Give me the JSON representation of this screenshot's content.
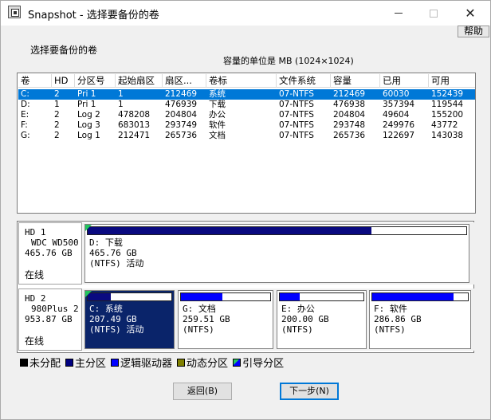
{
  "window": {
    "title": "Snapshot - 选择要备份的卷",
    "help_button": "帮助",
    "minimize_glyph": "—",
    "maximize_glyph": "□",
    "close_glyph": "✕"
  },
  "prompt": "选择要备份的卷",
  "unit_note": "容量的单位是 MB (1024×1024)",
  "volume_table": {
    "columns": [
      "卷",
      "HD",
      "分区号",
      "起始扇区",
      "扇区...",
      "卷标",
      "文件系统",
      "容量",
      "已用",
      "可用"
    ],
    "rows": [
      {
        "vol": "C:",
        "hd": "2",
        "part": "Pri 1",
        "start": "1",
        "sectors": "212469",
        "label": "系统",
        "fs": "07-NTFS",
        "capacity": "212469",
        "used": "60030",
        "free": "152439",
        "selected": true
      },
      {
        "vol": "D:",
        "hd": "1",
        "part": "Pri 1",
        "start": "1",
        "sectors": "476939",
        "label": "下载",
        "fs": "07-NTFS",
        "capacity": "476938",
        "used": "357394",
        "free": "119544",
        "selected": false
      },
      {
        "vol": "E:",
        "hd": "2",
        "part": "Log 2",
        "start": "478208",
        "sectors": "204804",
        "label": "办公",
        "fs": "07-NTFS",
        "capacity": "204804",
        "used": "49604",
        "free": "155200",
        "selected": false
      },
      {
        "vol": "F:",
        "hd": "2",
        "part": "Log 3",
        "start": "683013",
        "sectors": "293749",
        "label": "软件",
        "fs": "07-NTFS",
        "capacity": "293748",
        "used": "249976",
        "free": "43772",
        "selected": false
      },
      {
        "vol": "G:",
        "hd": "2",
        "part": "Log 1",
        "start": "212471",
        "sectors": "265736",
        "label": "文档",
        "fs": "07-NTFS",
        "capacity": "265736",
        "used": "122697",
        "free": "143038",
        "selected": false
      }
    ]
  },
  "disks": [
    {
      "name": "HD 1",
      "model": "WDC WD500",
      "size": "465.76 GB",
      "status": "在线",
      "partitions": [
        {
          "line1": "D: 下载",
          "line2": "465.76 GB",
          "line3": "(NTFS) 活动",
          "used_fraction": 0.75,
          "type": "primary",
          "boot": true,
          "selected": false
        }
      ]
    },
    {
      "name": "HD 2",
      "model": "980Plus 2",
      "size": "953.87 GB",
      "status": "在线",
      "partitions": [
        {
          "line1": "C: 系统",
          "line2": "207.49 GB",
          "line3": "(NTFS) 活动",
          "used_fraction": 0.28,
          "type": "primary",
          "boot": true,
          "selected": true
        },
        {
          "line1": "G: 文档",
          "line2": "259.51 GB",
          "line3": "(NTFS)",
          "used_fraction": 0.46,
          "type": "logical",
          "boot": false,
          "selected": false
        },
        {
          "line1": "E: 办公",
          "line2": "200.00 GB",
          "line3": "(NTFS)",
          "used_fraction": 0.24,
          "type": "logical",
          "boot": false,
          "selected": false
        },
        {
          "line1": "F: 软件",
          "line2": "286.86 GB",
          "line3": "(NTFS)",
          "used_fraction": 0.85,
          "type": "logical",
          "boot": false,
          "selected": false
        }
      ]
    }
  ],
  "legend": [
    {
      "label": "未分配",
      "color": "#000000"
    },
    {
      "label": "主分区",
      "color": "#000080"
    },
    {
      "label": "逻辑驱动器",
      "color": "#0000ff"
    },
    {
      "label": "动态分区",
      "color": "#808000"
    },
    {
      "label": "引导分区",
      "color": "#0000ff",
      "boot": true
    }
  ],
  "colors": {
    "primary_used": "#0a0a80",
    "logical_used": "#0000ff",
    "free": "#ffffff",
    "selection": "#0078d7",
    "selected_partition": "#0a246a",
    "boot_marker": "#22c55e"
  },
  "buttons": {
    "back": "返回(B)",
    "next": "下一步(N)"
  }
}
